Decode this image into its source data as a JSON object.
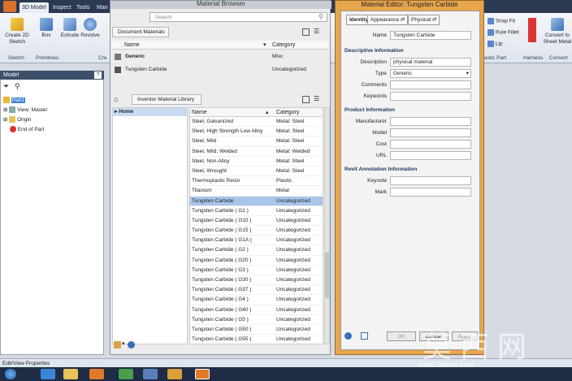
{
  "ribbon": {
    "tabs": [
      "3D Model",
      "Inspect",
      "Tools",
      "Man"
    ],
    "buttons": {
      "create_sketch": "Create 2D Sketch",
      "box": "Box",
      "extrude": "Extrude",
      "revolve": "Revolve"
    },
    "groups": {
      "sketch": "Sketch",
      "primitives": "Primitives",
      "create": "Cre"
    },
    "right_buttons": {
      "snap_fit": "Snap Fit",
      "rule_fillet": "Rule Fillet",
      "lip": "Lip",
      "convert": "Convert to Sheet Metal"
    },
    "right_groups": {
      "plastic_part": "astic Part",
      "harness": "Harness",
      "convert": "Convert"
    }
  },
  "sidebar": {
    "title": "Model",
    "tree": [
      {
        "label": "Part1",
        "selected": true
      },
      {
        "label": "View: Master"
      },
      {
        "label": "Origin"
      },
      {
        "label": "End of Part"
      }
    ]
  },
  "material_browser": {
    "title": "Material Browser",
    "search_placeholder": "Search",
    "document_materials_label": "Document Materials",
    "columns": {
      "name": "Name",
      "category": "Category"
    },
    "document_materials": [
      {
        "name": "Generic",
        "category": "Misc",
        "bold": true
      },
      {
        "name": "Tungsten Carbide",
        "category": "Uncategorized"
      }
    ],
    "library_label": "Inventor Material Library",
    "home_label": "Home",
    "library_materials": [
      {
        "name": "Steel, Galvanized",
        "category": "Metal: Steel"
      },
      {
        "name": "Steel, High Strength Low Alloy",
        "category": "Metal: Steel"
      },
      {
        "name": "Steel, Mild",
        "category": "Metal: Steel"
      },
      {
        "name": "Steel, Mild, Welded",
        "category": "Metal: Welded"
      },
      {
        "name": "Steel, Non-Alloy",
        "category": "Metal: Steel"
      },
      {
        "name": "Steel, Wrought",
        "category": "Metal: Steel"
      },
      {
        "name": "Thermoplastic Resin",
        "category": "Plastic"
      },
      {
        "name": "Titanium",
        "category": "Metal"
      },
      {
        "name": "Tungsten Carbide",
        "category": "Uncategorized",
        "selected": true
      },
      {
        "name": "Tungsten Carbide ( G1 )",
        "category": "Uncategorized"
      },
      {
        "name": "Tungsten Carbide ( G10 )",
        "category": "Uncategorized"
      },
      {
        "name": "Tungsten Carbide ( G15 )",
        "category": "Uncategorized"
      },
      {
        "name": "Tungsten Carbide ( G1A )",
        "category": "Uncategorized"
      },
      {
        "name": "Tungsten Carbide ( G2 )",
        "category": "Uncategorized"
      },
      {
        "name": "Tungsten Carbide ( G20 )",
        "category": "Uncategorized"
      },
      {
        "name": "Tungsten Carbide ( G3 )",
        "category": "Uncategorized"
      },
      {
        "name": "Tungsten Carbide ( G30 )",
        "category": "Uncategorized"
      },
      {
        "name": "Tungsten Carbide ( G37 )",
        "category": "Uncategorized"
      },
      {
        "name": "Tungsten Carbide ( G4 )",
        "category": "Uncategorized"
      },
      {
        "name": "Tungsten Carbide ( G40 )",
        "category": "Uncategorized"
      },
      {
        "name": "Tungsten Carbide ( G5 )",
        "category": "Uncategorized"
      },
      {
        "name": "Tungsten Carbide ( G50 )",
        "category": "Uncategorized"
      },
      {
        "name": "Tungsten Carbide ( G55 )",
        "category": "Uncategorized"
      }
    ]
  },
  "material_editor": {
    "title": "Material Editor: Tungsten Carbide",
    "tabs": [
      "Identity",
      "Appearance",
      "Physical"
    ],
    "name_label": "Name",
    "name_value": "Tungsten Carbide",
    "descriptive_section": "Descriptive Information",
    "description_label": "Description",
    "description_value": "physical material",
    "type_label": "Type",
    "type_value": "Generic",
    "comments_label": "Comments",
    "keywords_label": "Keywords",
    "product_section": "Product Information",
    "manufacturer_label": "Manufacturer",
    "model_label": "Model",
    "cost_label": "Cost",
    "url_label": "URL",
    "revit_section": "Revit Annotation Information",
    "keynote_label": "Keynote",
    "mark_label": "Mark",
    "ok_label": "OK",
    "cancel_label": "Cancel",
    "apply_label": "Apply"
  },
  "status_bar": {
    "text": "Edit/View Properties"
  },
  "watermark": {
    "chars": "莫西网",
    "url": "www.3dmox.com"
  }
}
